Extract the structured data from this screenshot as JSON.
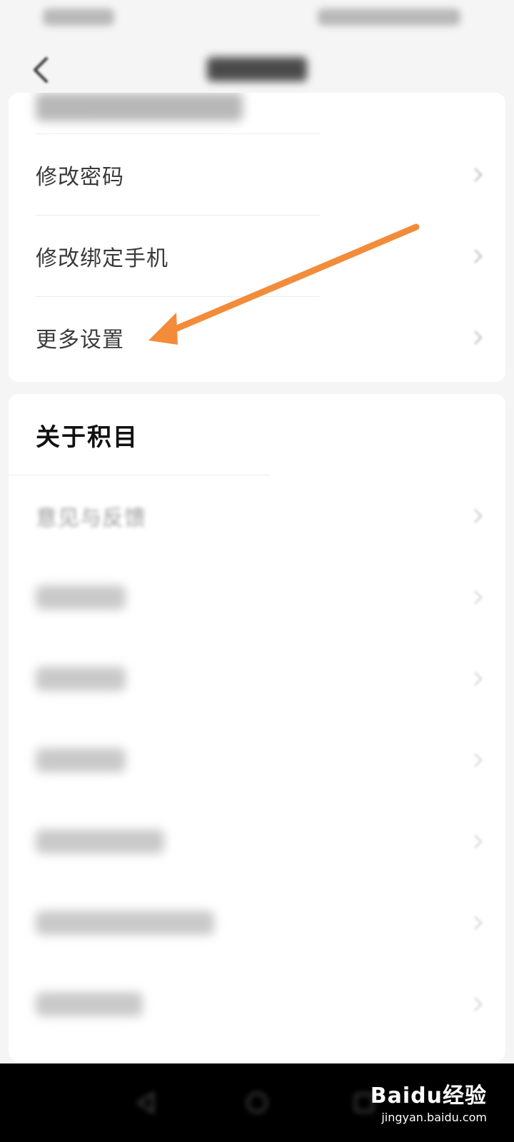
{
  "header": {
    "back_icon": "chevron-left-icon"
  },
  "account_rows": [
    {
      "label": "修改密码"
    },
    {
      "label": "修改绑定手机"
    },
    {
      "label": "更多设置"
    }
  ],
  "about": {
    "title": "关于积目",
    "feedback_label": "意见与反馈"
  },
  "annotation": {
    "arrow_color": "#f28c3a"
  },
  "watermark": {
    "main": "Baidu经验",
    "sub": "jingyan.baidu.com"
  }
}
